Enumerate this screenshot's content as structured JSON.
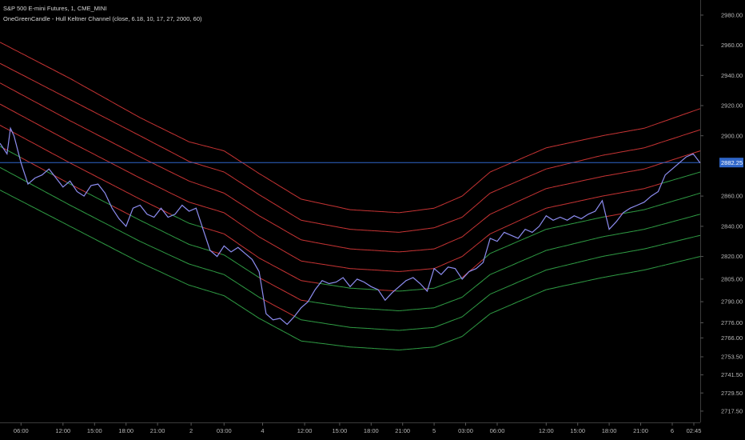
{
  "header": {
    "title": "S&P 500 E-mini Futures, 1, CME_MINI",
    "indicator": "OneGreenCandle - Hull Keltner Channel (close, 6.18, 10, 17, 27, 2000, 60)"
  },
  "chart_data": {
    "type": "line",
    "ylim": [
      2710,
      2990
    ],
    "x_range": [
      0,
      100
    ],
    "y_ticks": [
      "2980.00",
      "2960.00",
      "2940.00",
      "2920.00",
      "2900.00",
      "2860.00",
      "2840.00",
      "2820.00",
      "2805.00",
      "2790.00",
      "2776.00",
      "2766.00",
      "2753.50",
      "2741.50",
      "2729.50",
      "2717.50"
    ],
    "x_ticks": [
      {
        "label": "06:00",
        "x": 3
      },
      {
        "label": "12:00",
        "x": 9
      },
      {
        "label": "15:00",
        "x": 13.5
      },
      {
        "label": "18:00",
        "x": 18
      },
      {
        "label": "21:00",
        "x": 22.5
      },
      {
        "label": "2",
        "x": 27.3
      },
      {
        "label": "03:00",
        "x": 32
      },
      {
        "label": "4",
        "x": 37.5
      },
      {
        "label": "12:00",
        "x": 43.5
      },
      {
        "label": "15:00",
        "x": 48.5
      },
      {
        "label": "18:00",
        "x": 53
      },
      {
        "label": "21:00",
        "x": 57.5
      },
      {
        "label": "5",
        "x": 62
      },
      {
        "label": "03:00",
        "x": 66.5
      },
      {
        "label": "06:00",
        "x": 71
      },
      {
        "label": "12:00",
        "x": 78
      },
      {
        "label": "15:00",
        "x": 82.5
      },
      {
        "label": "18:00",
        "x": 87
      },
      {
        "label": "21:00",
        "x": 91.5
      },
      {
        "label": "6",
        "x": 96
      },
      {
        "label": "02:45",
        "x": 100
      }
    ],
    "last_price": {
      "label": "2882.25",
      "value": 2882.25
    },
    "price_series": {
      "name": "",
      "points": [
        [
          0,
          2895
        ],
        [
          1,
          2888
        ],
        [
          1.5,
          2905
        ],
        [
          2,
          2900
        ],
        [
          3,
          2882
        ],
        [
          4,
          2868
        ],
        [
          5,
          2872
        ],
        [
          6,
          2874
        ],
        [
          7,
          2878
        ],
        [
          8,
          2872
        ],
        [
          9,
          2866
        ],
        [
          10,
          2870
        ],
        [
          11,
          2863
        ],
        [
          12,
          2860
        ],
        [
          13,
          2867
        ],
        [
          14,
          2868
        ],
        [
          15,
          2862
        ],
        [
          16,
          2852
        ],
        [
          17,
          2845
        ],
        [
          18,
          2840
        ],
        [
          19,
          2852
        ],
        [
          20,
          2854
        ],
        [
          21,
          2848
        ],
        [
          22,
          2846
        ],
        [
          23,
          2852
        ],
        [
          24,
          2846
        ],
        [
          25,
          2848
        ],
        [
          26,
          2854
        ],
        [
          27,
          2850
        ],
        [
          28,
          2852
        ],
        [
          29,
          2838
        ],
        [
          30,
          2824
        ],
        [
          31,
          2820
        ],
        [
          32,
          2827
        ],
        [
          33,
          2823
        ],
        [
          34,
          2826
        ],
        [
          35,
          2822
        ],
        [
          36,
          2818
        ],
        [
          37,
          2810
        ],
        [
          38,
          2782
        ],
        [
          39,
          2778
        ],
        [
          40,
          2779
        ],
        [
          41,
          2775
        ],
        [
          42,
          2780
        ],
        [
          43,
          2786
        ],
        [
          44,
          2790
        ],
        [
          45,
          2798
        ],
        [
          46,
          2804
        ],
        [
          47,
          2802
        ],
        [
          48,
          2803
        ],
        [
          49,
          2806
        ],
        [
          50,
          2800
        ],
        [
          51,
          2805
        ],
        [
          52,
          2803
        ],
        [
          53,
          2800
        ],
        [
          54,
          2798
        ],
        [
          55,
          2791
        ],
        [
          56,
          2796
        ],
        [
          57,
          2800
        ],
        [
          58,
          2804
        ],
        [
          59,
          2806
        ],
        [
          60,
          2802
        ],
        [
          61,
          2797
        ],
        [
          62,
          2812
        ],
        [
          63,
          2808
        ],
        [
          64,
          2813
        ],
        [
          65,
          2812
        ],
        [
          66,
          2805
        ],
        [
          67,
          2810
        ],
        [
          68,
          2812
        ],
        [
          69,
          2816
        ],
        [
          70,
          2832
        ],
        [
          71,
          2830
        ],
        [
          72,
          2836
        ],
        [
          73,
          2834
        ],
        [
          74,
          2832
        ],
        [
          75,
          2838
        ],
        [
          76,
          2836
        ],
        [
          77,
          2840
        ],
        [
          78,
          2847
        ],
        [
          79,
          2844
        ],
        [
          80,
          2846
        ],
        [
          81,
          2844
        ],
        [
          82,
          2847
        ],
        [
          83,
          2845
        ],
        [
          84,
          2848
        ],
        [
          85,
          2850
        ],
        [
          86,
          2857
        ],
        [
          87,
          2838
        ],
        [
          88,
          2843
        ],
        [
          89,
          2849
        ],
        [
          90,
          2852
        ],
        [
          91,
          2854
        ],
        [
          92,
          2856
        ],
        [
          93,
          2860
        ],
        [
          94,
          2863
        ],
        [
          95,
          2874
        ],
        [
          96,
          2878
        ],
        [
          97,
          2882
        ],
        [
          98,
          2886
        ],
        [
          99,
          2888
        ],
        [
          100,
          2882
        ]
      ]
    },
    "bands": [
      {
        "name": "",
        "points": [
          [
            0,
            2962
          ],
          [
            10,
            2938
          ],
          [
            20,
            2912
          ],
          [
            27,
            2896
          ],
          [
            32,
            2890
          ],
          [
            37,
            2875
          ],
          [
            43,
            2858
          ],
          [
            50,
            2851
          ],
          [
            57,
            2849
          ],
          [
            62,
            2852
          ],
          [
            66,
            2860
          ],
          [
            70,
            2876
          ],
          [
            78,
            2892
          ],
          [
            86,
            2900
          ],
          [
            92,
            2905
          ],
          [
            100,
            2918
          ]
        ]
      },
      {
        "name": "",
        "points": [
          [
            0,
            2948
          ],
          [
            10,
            2924
          ],
          [
            20,
            2900
          ],
          [
            27,
            2883
          ],
          [
            32,
            2876
          ],
          [
            37,
            2861
          ],
          [
            43,
            2844
          ],
          [
            50,
            2838
          ],
          [
            57,
            2836
          ],
          [
            62,
            2839
          ],
          [
            66,
            2846
          ],
          [
            70,
            2862
          ],
          [
            78,
            2878
          ],
          [
            86,
            2887
          ],
          [
            92,
            2892
          ],
          [
            100,
            2904
          ]
        ]
      },
      {
        "name": "",
        "points": [
          [
            0,
            2935
          ],
          [
            10,
            2910
          ],
          [
            20,
            2886
          ],
          [
            27,
            2870
          ],
          [
            32,
            2862
          ],
          [
            37,
            2847
          ],
          [
            43,
            2831
          ],
          [
            50,
            2825
          ],
          [
            57,
            2823
          ],
          [
            62,
            2825
          ],
          [
            66,
            2833
          ],
          [
            70,
            2848
          ],
          [
            78,
            2865
          ],
          [
            86,
            2873
          ],
          [
            92,
            2878
          ],
          [
            100,
            2890
          ]
        ]
      },
      {
        "name": "",
        "points": [
          [
            0,
            2921
          ],
          [
            10,
            2896
          ],
          [
            20,
            2872
          ],
          [
            27,
            2856
          ],
          [
            32,
            2849
          ],
          [
            37,
            2833
          ],
          [
            43,
            2817
          ],
          [
            50,
            2812
          ],
          [
            57,
            2810
          ],
          [
            62,
            2812
          ],
          [
            66,
            2820
          ],
          [
            70,
            2835
          ],
          [
            78,
            2852
          ],
          [
            86,
            2860
          ],
          [
            92,
            2865
          ],
          [
            100,
            2876
          ]
        ]
      },
      {
        "name": "",
        "points": [
          [
            0,
            2907
          ],
          [
            10,
            2882
          ],
          [
            20,
            2858
          ],
          [
            27,
            2842
          ],
          [
            32,
            2835
          ],
          [
            37,
            2819
          ],
          [
            43,
            2804
          ],
          [
            50,
            2799
          ],
          [
            57,
            2797
          ],
          [
            62,
            2799
          ],
          [
            66,
            2806
          ],
          [
            70,
            2822
          ],
          [
            78,
            2838
          ],
          [
            86,
            2846
          ],
          [
            92,
            2851
          ],
          [
            100,
            2862
          ]
        ]
      },
      {
        "name": "",
        "points": [
          [
            0,
            2893
          ],
          [
            10,
            2868
          ],
          [
            20,
            2844
          ],
          [
            27,
            2828
          ],
          [
            32,
            2821
          ],
          [
            37,
            2806
          ],
          [
            43,
            2791
          ],
          [
            50,
            2786
          ],
          [
            57,
            2784
          ],
          [
            62,
            2786
          ],
          [
            66,
            2793
          ],
          [
            70,
            2808
          ],
          [
            78,
            2824
          ],
          [
            86,
            2833
          ],
          [
            92,
            2838
          ],
          [
            100,
            2848
          ]
        ]
      },
      {
        "name": "",
        "points": [
          [
            0,
            2879
          ],
          [
            10,
            2854
          ],
          [
            20,
            2830
          ],
          [
            27,
            2815
          ],
          [
            32,
            2808
          ],
          [
            37,
            2793
          ],
          [
            43,
            2778
          ],
          [
            50,
            2773
          ],
          [
            57,
            2771
          ],
          [
            62,
            2773
          ],
          [
            66,
            2780
          ],
          [
            70,
            2795
          ],
          [
            78,
            2811
          ],
          [
            86,
            2820
          ],
          [
            92,
            2825
          ],
          [
            100,
            2834
          ]
        ]
      },
      {
        "name": "",
        "points": [
          [
            0,
            2864
          ],
          [
            10,
            2840
          ],
          [
            20,
            2816
          ],
          [
            27,
            2801
          ],
          [
            32,
            2794
          ],
          [
            37,
            2779
          ],
          [
            43,
            2764
          ],
          [
            50,
            2760
          ],
          [
            57,
            2758
          ],
          [
            62,
            2760
          ],
          [
            66,
            2767
          ],
          [
            70,
            2782
          ],
          [
            78,
            2798
          ],
          [
            86,
            2806
          ],
          [
            92,
            2811
          ],
          [
            100,
            2820
          ]
        ]
      }
    ],
    "band_colors": {
      "above": "#2f9c44",
      "below": "#c83434"
    },
    "price_color": "#8d8df0",
    "price_line_color": "#2f66c9",
    "grid": false
  }
}
